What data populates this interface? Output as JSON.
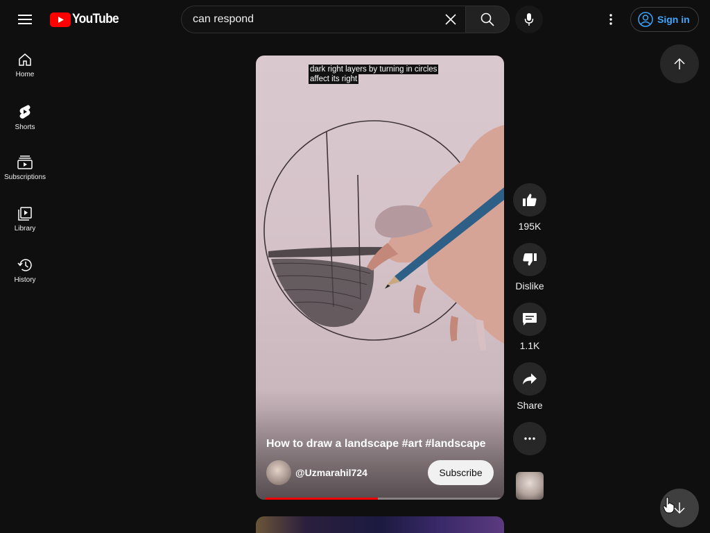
{
  "header": {
    "logo_text": "YouTube",
    "search": {
      "value": "can respond",
      "placeholder": "Search"
    },
    "signin_label": "Sign in"
  },
  "sidebar": {
    "items": [
      {
        "label": "Home",
        "icon": "home-icon"
      },
      {
        "label": "Shorts",
        "icon": "shorts-icon"
      },
      {
        "label": "Subscriptions",
        "icon": "subscriptions-icon"
      },
      {
        "label": "Library",
        "icon": "library-icon"
      },
      {
        "label": "History",
        "icon": "history-icon"
      }
    ]
  },
  "short": {
    "caption_line1": "dark right layers by turning in circles",
    "caption_line2": "affect its right",
    "title": "How to draw a landscape #art #landscape",
    "channel": "@Uzmarahil724",
    "subscribe_label": "Subscribe",
    "progress_fraction": 0.47
  },
  "actions": {
    "like_count": "195K",
    "dislike_label": "Dislike",
    "comment_count": "1.1K",
    "share_label": "Share"
  },
  "colors": {
    "background": "#0f0f0f",
    "accent_red": "#ff0000",
    "link_blue": "#3ea6ff",
    "button_gray": "#272727"
  }
}
